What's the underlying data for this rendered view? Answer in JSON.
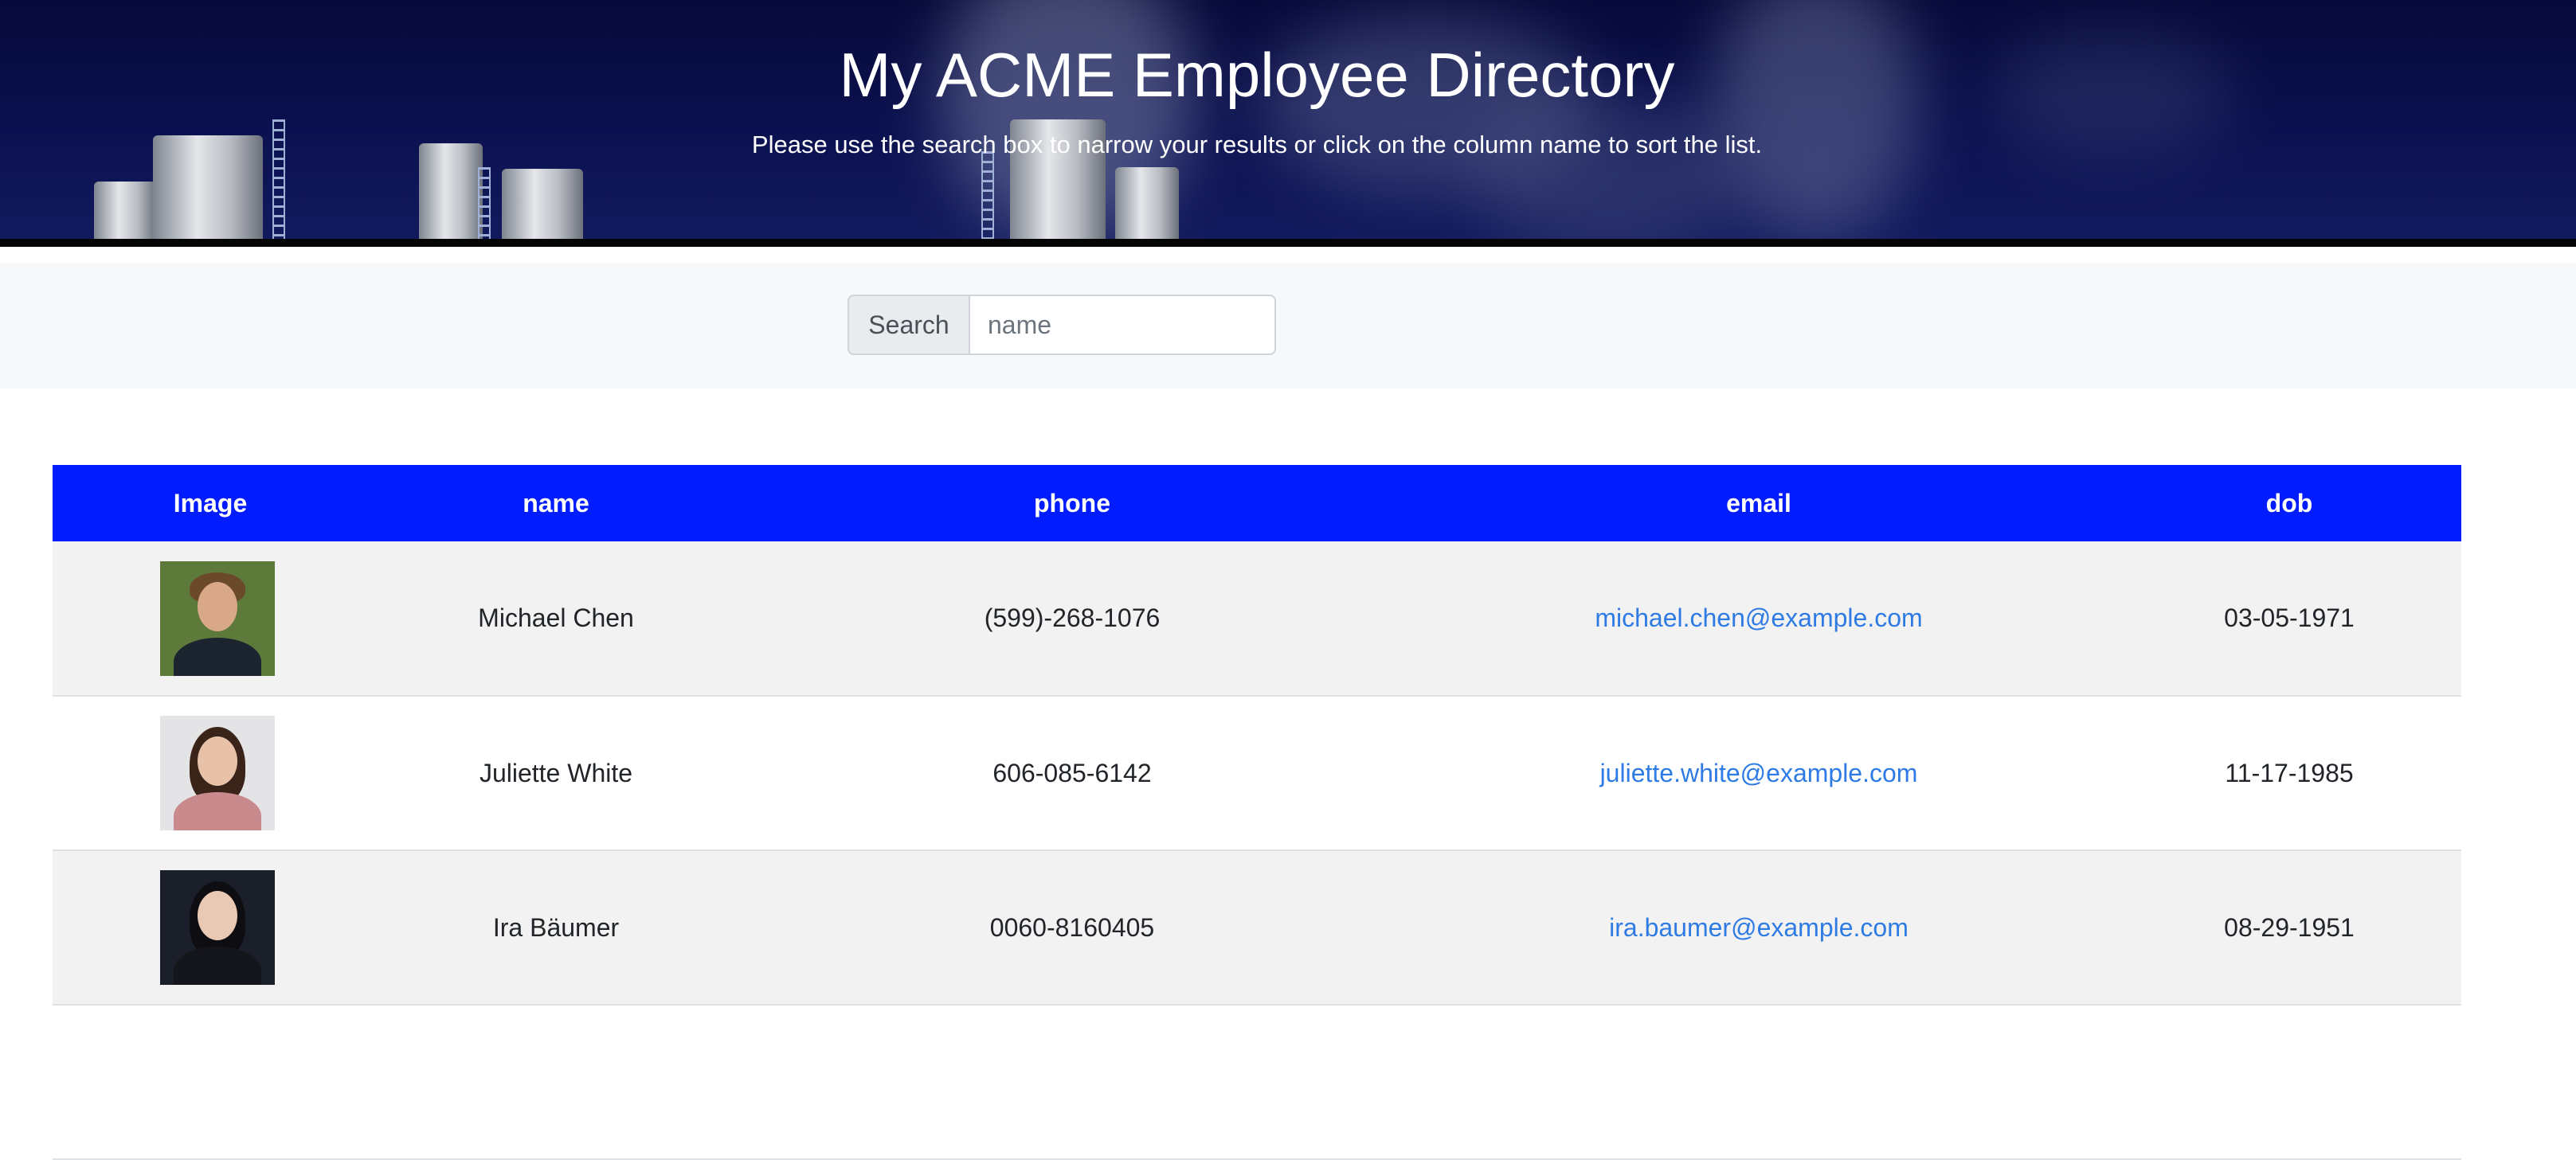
{
  "header": {
    "title": "My ACME Employee Directory",
    "subtitle": "Please use the search box to narrow your results or click on the column name to sort the list."
  },
  "search": {
    "label": "Search",
    "placeholder": "name",
    "value": ""
  },
  "table": {
    "columns": [
      "Image",
      "name",
      "phone",
      "email",
      "dob"
    ],
    "rows": [
      {
        "name": "Michael Chen",
        "phone": "(599)-268-1076",
        "email": "michael.chen@example.com",
        "dob": "03-05-1971",
        "avatar": {
          "bg": "#5d7a3a",
          "hair": "#6b4a2b",
          "skin": "#d9a888",
          "clothing": "#1c2430"
        }
      },
      {
        "name": "Juliette White",
        "phone": "606-085-6142",
        "email": "juliette.white@example.com",
        "dob": "11-17-1985",
        "avatar": {
          "bg": "#e4e4e6",
          "hair": "#3a2419",
          "skin": "#e7c2a8",
          "clothing": "#c98a8e"
        }
      },
      {
        "name": "Ira Bäumer",
        "phone": "0060-8160405",
        "email": "ira.baumer@example.com",
        "dob": "08-29-1951",
        "avatar": {
          "bg": "#1b1f2a",
          "hair": "#0e0e12",
          "skin": "#eac9b4",
          "clothing": "#15161c"
        }
      }
    ]
  },
  "colors": {
    "table_header": "#001cff",
    "link": "#2f7be4",
    "hero_dark": "#060a3a"
  }
}
